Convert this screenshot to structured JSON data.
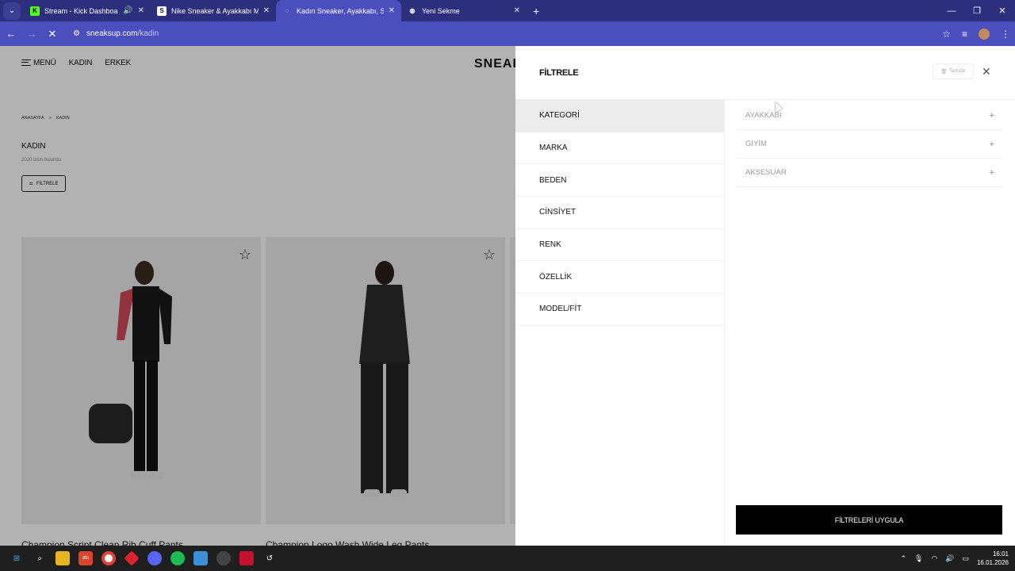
{
  "browser": {
    "tabs": [
      {
        "title": "Stream - Kick Dashboard",
        "favicon": "kick-icon",
        "fav_color": "#53fc18",
        "fav_glyph": "K",
        "active": false,
        "audio": true
      },
      {
        "title": "Nike Sneaker & Ayakkabı Mode",
        "favicon": "sneaksup-icon",
        "fav_color": "#111111",
        "fav_glyph": "S",
        "active": false,
        "audio": false
      },
      {
        "title": "Kadın Sneaker, Ayakkabı, Spor",
        "favicon": "loading-icon",
        "fav_color": "#4a4fbd",
        "fav_glyph": "◌",
        "active": true,
        "audio": false
      },
      {
        "title": "Yeni Sekme",
        "favicon": "chrome-icon",
        "fav_color": "#ffffff",
        "fav_glyph": "◍",
        "active": false,
        "audio": false
      }
    ],
    "url_host": "sneaksup.com",
    "url_path": "/kadin"
  },
  "site": {
    "menu_label": "MENÜ",
    "nav": [
      "KADIN",
      "ERKEK"
    ],
    "logo": "SNEAK",
    "breadcrumb": [
      "ANASAYFA",
      ">",
      "KADIN"
    ],
    "category_title": "KADIN",
    "result_count": "2020 ürün bulundu",
    "filter_button": "FİLTRELE",
    "products": [
      {
        "name": "Champion Script Clean Rib Cuff Pants"
      },
      {
        "name": "Champion Logo Wash Wide Leg Pants"
      }
    ]
  },
  "filter_panel": {
    "title": "FİLTRELE",
    "clear_label": "Temizle",
    "categories": [
      "KATEGORİ",
      "MARKA",
      "BEDEN",
      "CİNSİYET",
      "RENK",
      "ÖZELLİK",
      "MODEL/FİT"
    ],
    "active_category": "KATEGORİ",
    "subcategories": [
      "AYAKKABI",
      "GİYİM",
      "AKSESUAR"
    ],
    "apply_label": "FİLTRELERİ UYGULA"
  },
  "taskbar": {
    "time": "16:01",
    "date": "16.01.2026"
  }
}
